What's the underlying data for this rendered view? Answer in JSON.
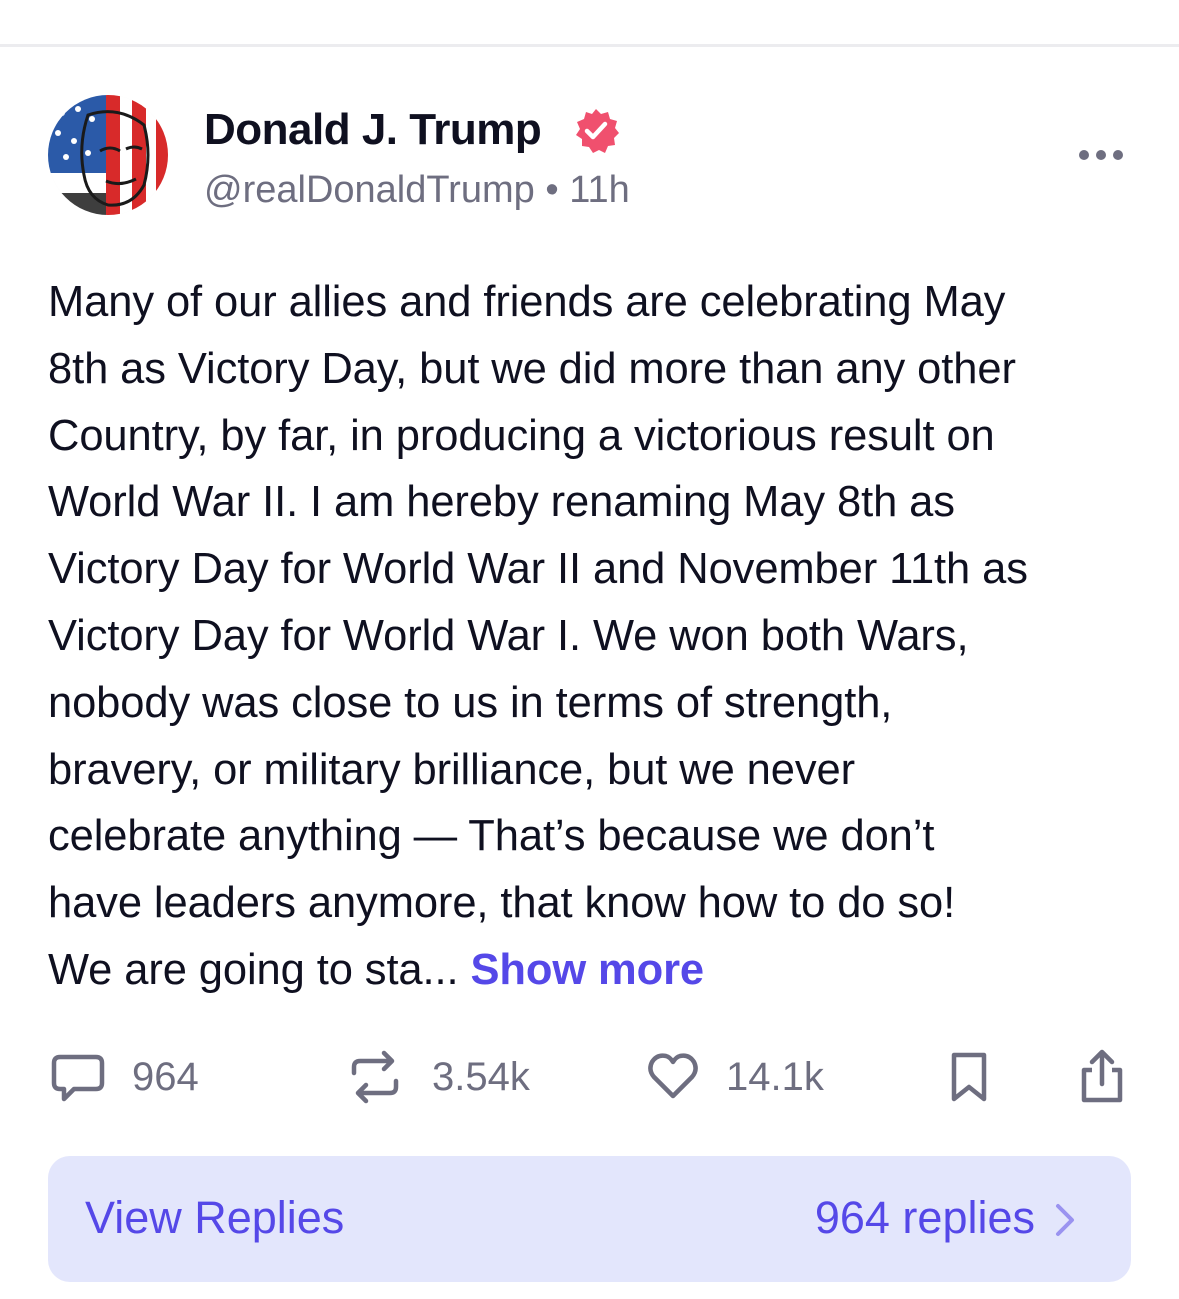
{
  "post": {
    "author": {
      "name": "Donald J. Trump",
      "handle": "@realDonaldTrump",
      "separator": "•",
      "time": "11h"
    },
    "body": "Many of our allies and friends are celebrating May\n8th as Victory Day, but we did more than any other\nCountry, by far, in producing a victorious result on\nWorld War II. I am hereby renaming May 8th as\nVictory Day for World War II and November 11th as\nVictory Day for World War I. We won both Wars,\nnobody was close to us in terms of strength,\nbravery, or military brilliance, but we never\ncelebrate anything — That’s because we don’t\nhave leaders  anymore, that know how to do so!\nWe are going to sta... ",
    "show_more": "Show more",
    "actions": {
      "replies": "964",
      "reposts": "3.54k",
      "likes": "14.1k"
    },
    "view_replies": {
      "label": "View Replies",
      "count": "964 replies"
    }
  },
  "icons": {
    "verified": "verified-badge-icon",
    "more": "more-options-icon",
    "reply": "comment-icon",
    "repost": "repost-icon",
    "like": "heart-icon",
    "bookmark": "bookmark-icon",
    "share": "share-icon",
    "chevron": "chevron-right-icon"
  },
  "colors": {
    "accent": "#5548e8",
    "verified": "#f0506e",
    "muted": "#6e6e80",
    "replies_bg": "#e3e6fc"
  }
}
